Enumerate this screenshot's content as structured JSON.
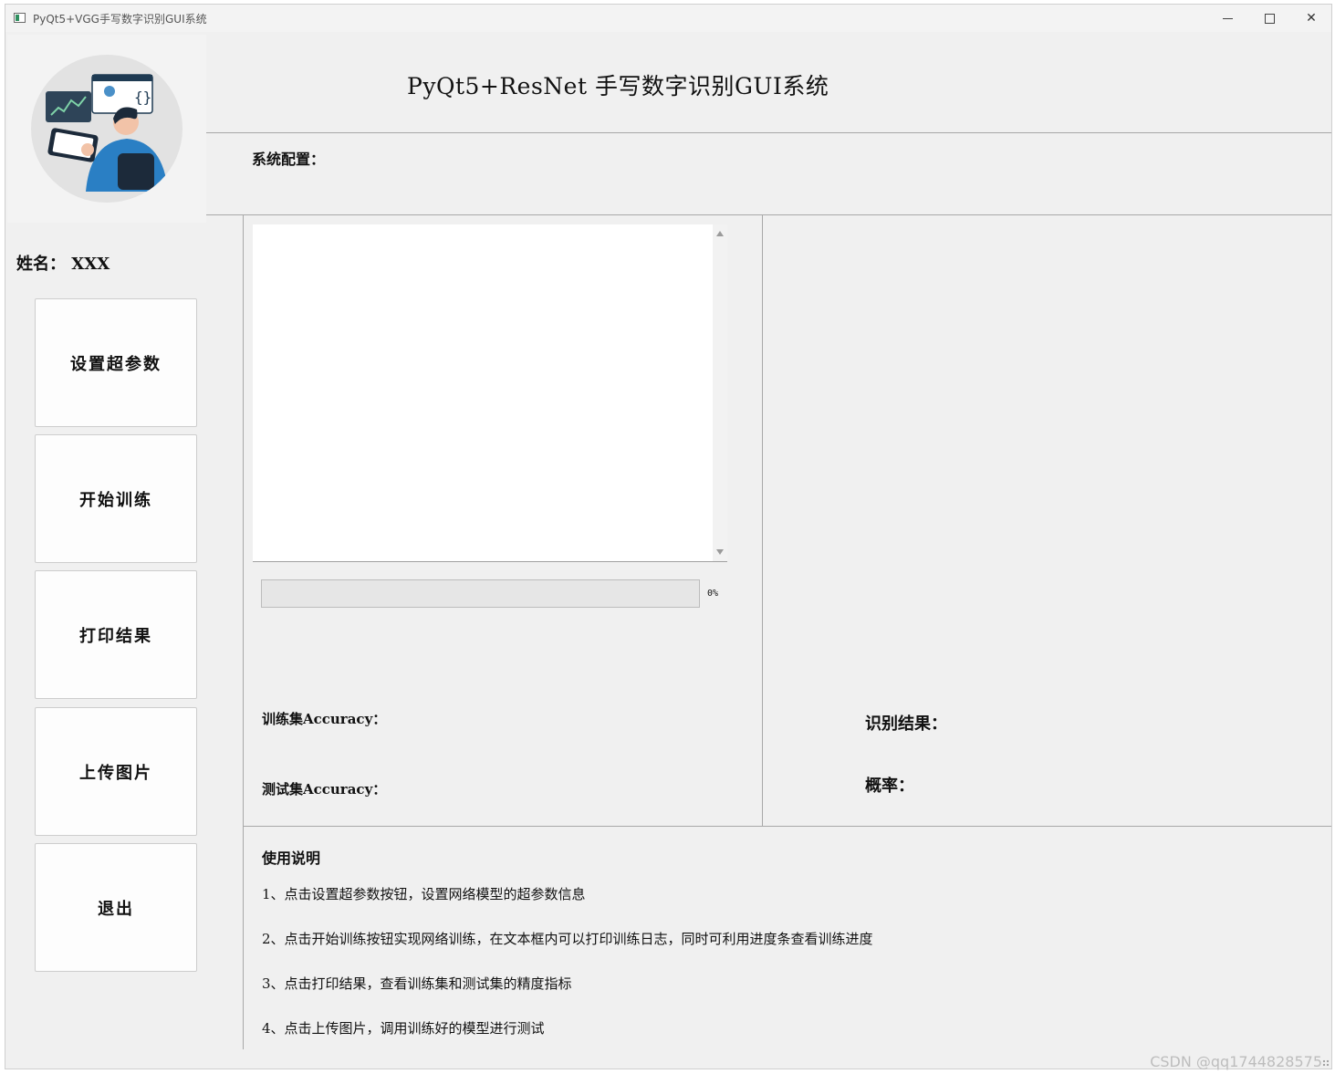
{
  "window": {
    "title": "PyQt5+VGG手写数字识别GUI系统",
    "minimize_glyph": "",
    "maximize_glyph": "",
    "close_glyph": "✕"
  },
  "header": {
    "title": "PyQt5+ResNet 手写数字识别GUI系统",
    "config_label": "系统配置："
  },
  "sidebar": {
    "name_label": "姓名： XXX",
    "buttons": [
      {
        "label": "设置超参数"
      },
      {
        "label": "开始训练"
      },
      {
        "label": "打印结果"
      },
      {
        "label": "上传图片"
      },
      {
        "label": "退出"
      }
    ]
  },
  "training": {
    "log_text": "",
    "progress_value": 0,
    "progress_text": "0%",
    "train_acc_label": "训练集Accuracy：",
    "test_acc_label": "测试集Accuracy："
  },
  "recognition": {
    "result_label": "识别结果：",
    "probability_label": "概率："
  },
  "instructions": {
    "title": "使用说明",
    "lines": [
      "1、点击设置超参数按钮，设置网络模型的超参数信息",
      "2、点击开始训练按钮实现网络训练，在文本框内可以打印训练日志，同时可利用进度条查看训练进度",
      "3、点击打印结果，查看训练集和测试集的精度指标",
      "4、点击上传图片，调用训练好的模型进行测试"
    ]
  },
  "watermark": "CSDN @qq1744828575",
  "colors": {
    "window_bg": "#f0f0f0",
    "button_bg": "#fdfdfd",
    "divider": "#a8a8a8",
    "progress_fill": "#06b025"
  }
}
